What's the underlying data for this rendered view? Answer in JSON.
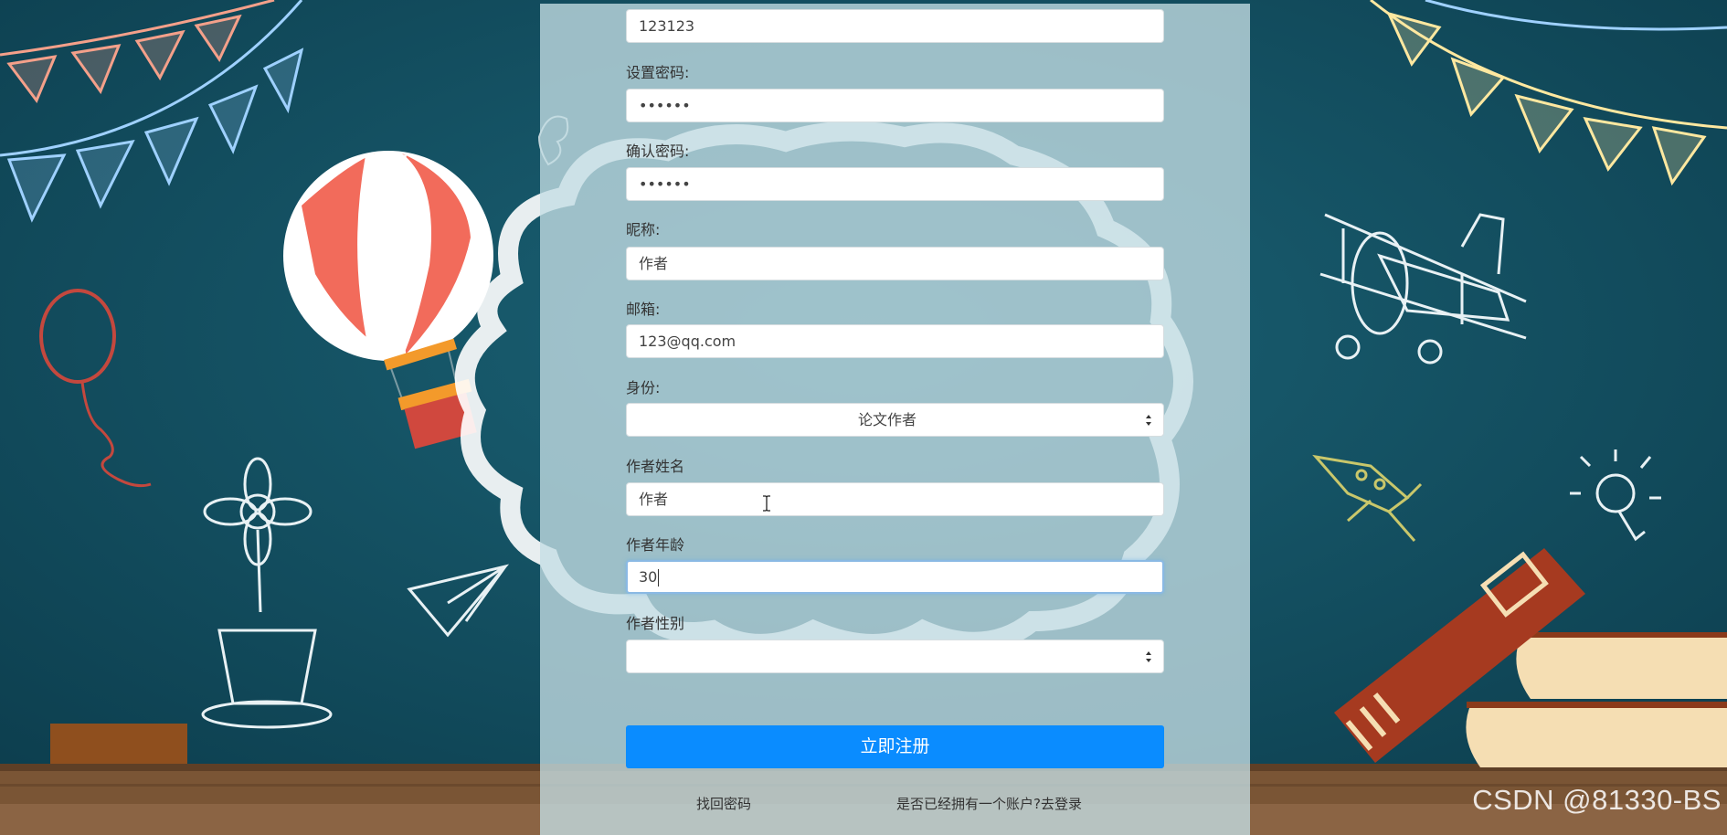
{
  "form": {
    "account": {
      "value": "123123"
    },
    "password": {
      "label": "设置密码:",
      "value": "••••••"
    },
    "confirm_password": {
      "label": "确认密码:",
      "value": "••••••"
    },
    "nickname": {
      "label": "昵称:",
      "value": "作者"
    },
    "email": {
      "label": "邮箱:",
      "value": "123@qq.com"
    },
    "role": {
      "label": "身份:",
      "value": "论文作者"
    },
    "author_name": {
      "label": "作者姓名",
      "value": "作者"
    },
    "author_age": {
      "label": "作者年龄",
      "value": "30"
    },
    "author_gender": {
      "label": "作者性别",
      "value": ""
    },
    "register_button": "立即注册"
  },
  "links": {
    "forgot_password": "找回密码",
    "have_account": "是否已经拥有一个账户?去登录"
  },
  "watermark": "CSDN @81330-BS",
  "colors": {
    "chalkboard": "#114a5c",
    "panel": "#c4dee4",
    "button": "#0a8cff",
    "floor": "#7a5535"
  },
  "background_icons": [
    "bunting-flags",
    "hot-air-balloon",
    "balloon",
    "flower-pot",
    "paper-plane",
    "butterfly",
    "cloud-frame",
    "biplane",
    "rocket",
    "light-bulb",
    "books",
    "eraser"
  ]
}
